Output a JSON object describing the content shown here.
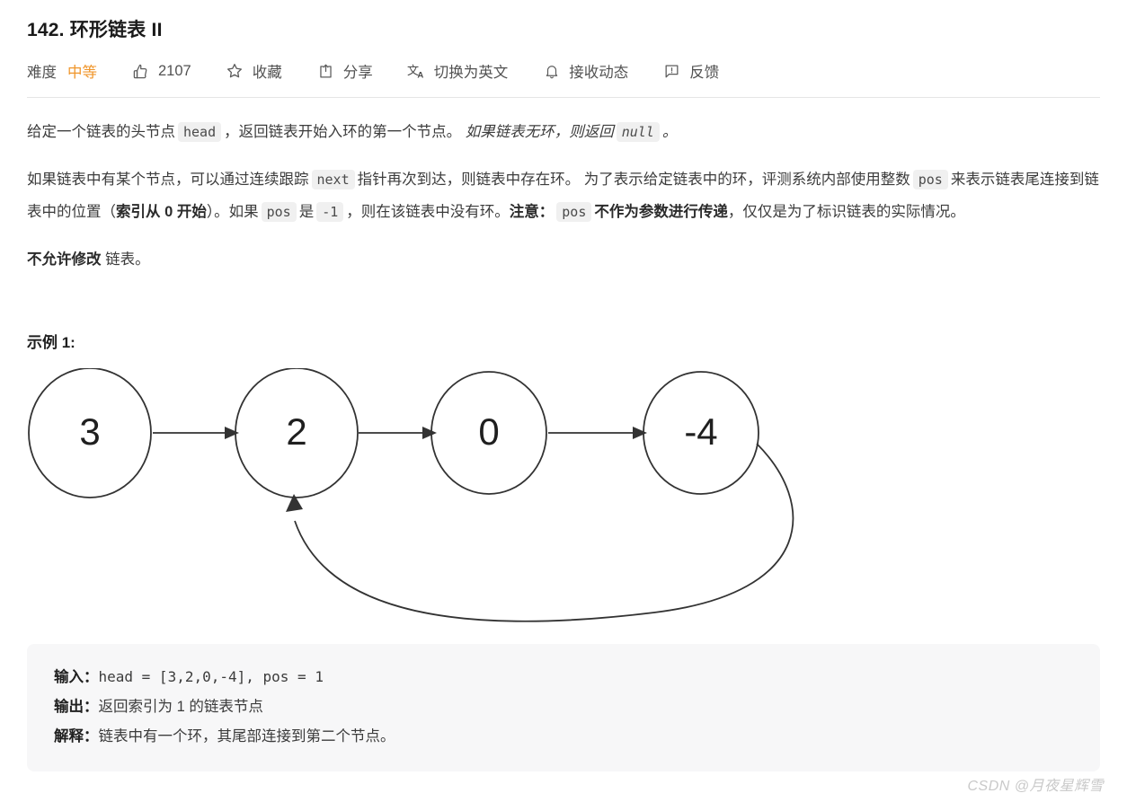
{
  "problem": {
    "number_title": "142. 环形链表 II"
  },
  "toolbar": {
    "difficulty_label": "难度",
    "difficulty_value": "中等",
    "likes_count": "2107",
    "favorite_label": "收藏",
    "share_label": "分享",
    "translate_label": "切换为英文",
    "notify_label": "接收动态",
    "feedback_label": "反馈",
    "icons": {
      "thumbs_up": "thumbs-up-icon",
      "star": "star-icon",
      "share": "share-icon",
      "translate": "translate-icon",
      "bell": "bell-icon",
      "feedback": "feedback-icon"
    }
  },
  "description": {
    "p1": {
      "seg1": "给定一个链表的头节点",
      "code1": "head",
      "seg2": "，返回链表开始入环的第一个节点。",
      "italic": "如果链表无环，则返回",
      "code2": "null",
      "seg3": "。"
    },
    "p2": {
      "seg1": "如果链表中有某个节点，可以通过连续跟踪",
      "code1": "next",
      "seg2": "指针再次到达，则链表中存在环。 为了表示给定链表中的环，评测系统内部使用整数",
      "code2": "pos",
      "seg3": "来表示链表尾连接到链表中的位置（",
      "bold1": "索引从 0 开始",
      "seg4": "）。如果",
      "code3": "pos",
      "seg5": "是",
      "code4": "-1",
      "seg6": "，则在该链表中没有环。",
      "bold2": "注意：",
      "code5": "pos",
      "bold3": "不作为参数进行传递",
      "seg7": "，仅仅是为了标识链表的实际情况。"
    },
    "p3": {
      "bold1": "不允许修改",
      "seg1": "链表。"
    }
  },
  "example": {
    "heading": "示例 1:",
    "diagram": {
      "nodes": [
        "3",
        "2",
        "0",
        "-4"
      ],
      "cycle_from": "-4",
      "cycle_to": "2"
    },
    "code": {
      "input_label": "输入：",
      "input_value": "head = [3,2,0,-4], pos = 1",
      "output_label": "输出：",
      "output_value": "返回索引为 1 的链表节点",
      "explain_label": "解释：",
      "explain_value": "链表中有一个环，其尾部连接到第二个节点。"
    }
  },
  "watermark": {
    "text": "CSDN @月夜星辉雪"
  },
  "colors": {
    "difficulty": "#f0962b",
    "code_bg": "#f0f0f0",
    "block_bg": "#f7f7f8",
    "text": "#3c3c3c"
  }
}
